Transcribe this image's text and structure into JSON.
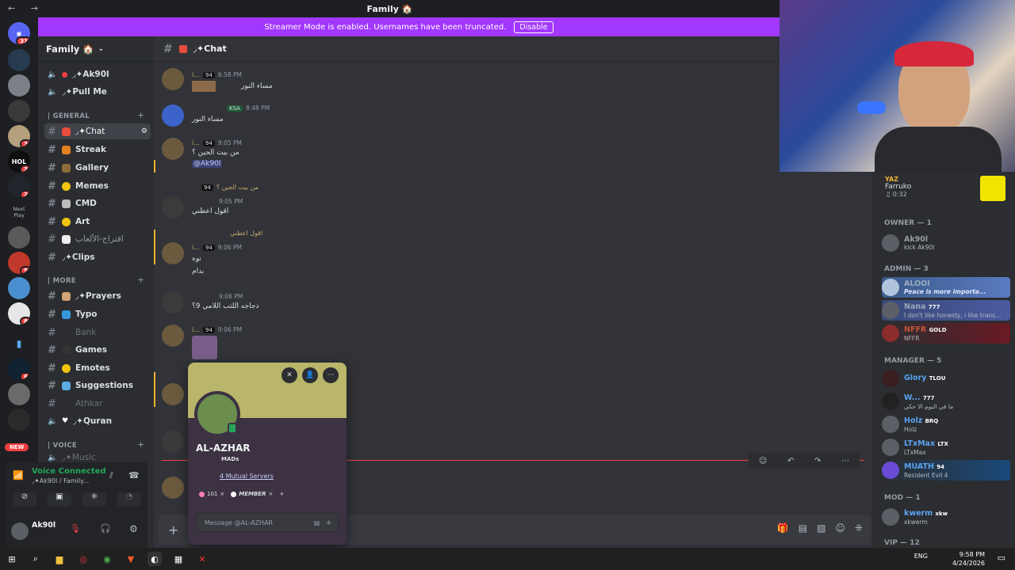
{
  "window": {
    "title": "Family 🏠",
    "nav": "← →"
  },
  "banner": {
    "text": "Streamer Mode is enabled. Usernames have been truncated.",
    "button": "Disable"
  },
  "servers": [
    {
      "label": "31",
      "badge": "31"
    },
    {
      "label": ""
    },
    {
      "label": ""
    },
    {
      "label": ""
    },
    {
      "label": "",
      "badge": "3"
    },
    {
      "label": "HOL",
      "badge": "3"
    },
    {
      "label": "",
      "badge": "2"
    },
    {
      "label": "Next Play"
    },
    {
      "label": ""
    },
    {
      "label": "",
      "badge": "5"
    },
    {
      "label": ""
    },
    {
      "label": "",
      "badge": "8"
    },
    {
      "label": ""
    },
    {
      "label": "",
      "badge": "6"
    },
    {
      "label": ""
    },
    {
      "label": ""
    }
  ],
  "new_badge": "NEW",
  "guild": {
    "name": "Family 🏠"
  },
  "voice_users": [
    "◞✦Ak90l",
    "◞✦Pull Me"
  ],
  "categories": {
    "general": "| GENERAL",
    "more": "| MORE",
    "voice": "| VOICE"
  },
  "general_channels": [
    {
      "name": "◞✦Chat",
      "active": true
    },
    {
      "name": "Streak"
    },
    {
      "name": "Gallery"
    },
    {
      "name": "Memes"
    },
    {
      "name": "CMD"
    },
    {
      "name": "Art"
    },
    {
      "name": "اقتراح-الألعاب"
    },
    {
      "name": "◞✦Clips"
    }
  ],
  "more_channels": [
    {
      "name": "◞✦Prayers"
    },
    {
      "name": "Typo"
    },
    {
      "name": "Bank"
    },
    {
      "name": "Games"
    },
    {
      "name": "Emotes"
    },
    {
      "name": "Suggestions"
    },
    {
      "name": "Athkar"
    },
    {
      "name": "◞✦Quran"
    }
  ],
  "voice_channel_partial": "◞✦Music",
  "voice_panel": {
    "status": "Voice Connected",
    "channel": "◞✦Ak90l / Family...",
    "user": "Ak90l"
  },
  "chat": {
    "channel": "◞✦Chat",
    "composer_placeholder": "+"
  },
  "messages": [
    {
      "name": "i...",
      "tag": "94",
      "time": "6:58 PM",
      "text": "مساء النور"
    },
    {
      "name": "",
      "tag": "KSA",
      "time": "8:48 PM",
      "text": "مساء النور"
    },
    {
      "name": "i...",
      "tag": "94",
      "time": "9:05 PM",
      "text": "من بيت الجين ؟",
      "mention": "@Ak90l"
    },
    {
      "name": "",
      "tag": "",
      "time": "9:05 PM",
      "reply": "من بيت الجين ؟",
      "reply_tag": "94",
      "text": "اقول اعطني"
    },
    {
      "name": "i...",
      "tag": "94",
      "time": "9:06 PM",
      "reply": "اقول اعطني",
      "text": "نوه",
      "text2": "بدام"
    },
    {
      "name": "",
      "tag": "",
      "time": "9:06 PM",
      "text": "دجاجه اللتب اللامي 9؟"
    },
    {
      "name": "i...",
      "tag": "94",
      "time": "9:06 PM",
      "text": ""
    }
  ],
  "profile": {
    "name": "AL-AZHAR",
    "sub": "MADs",
    "mutual": "4 Mutual Servers",
    "roles": [
      "101",
      "MEMBER"
    ],
    "message_placeholder": "Message @AL-AZHAR"
  },
  "now_playing": {
    "user": "YAZ",
    "song": "Farruko",
    "time": "0:32"
  },
  "member_categories": {
    "owner": "OWNER — 1",
    "admin": "ADMIN — 3",
    "manager": "MANAGER — 5",
    "mod": "MOD — 1",
    "vip": "VIP — 12"
  },
  "members": {
    "owner": [
      {
        "name": "Ak90l",
        "status": "kick Ak90l"
      }
    ],
    "admin": [
      {
        "name": "ALOOI",
        "status": "Peace is more importa..."
      },
      {
        "name": "Nana",
        "tag": "777",
        "status": "I don't like honesty, i like trans..."
      },
      {
        "name": "NFFR",
        "tag": "GOLD",
        "status": "NFFR"
      }
    ],
    "manager": [
      {
        "name": "Glory",
        "tag": "TLOU",
        "color": "#5aa3f0"
      },
      {
        "name": "W...",
        "tag": "777",
        "status": "ما في اليوم الا حكي",
        "color": "#5aa3f0"
      },
      {
        "name": "Holz",
        "tag": "BRQ",
        "status": "Holz",
        "color": "#5aa3f0"
      },
      {
        "name": "LTxMax",
        "tag": "LTX",
        "status": "LTxMax",
        "color": "#5aa3f0"
      },
      {
        "name": "MUATH",
        "tag": "94",
        "status": "Resident Evil 4",
        "color": "#5aa3f0"
      }
    ],
    "mod": [
      {
        "name": "kwerm",
        "tag": "xkw",
        "status": "xkwerm",
        "color": "#5aa3f0"
      }
    ]
  },
  "clock": {
    "time": "9:58 PM",
    "date": "4/24/2026",
    "lang": "ENG"
  }
}
